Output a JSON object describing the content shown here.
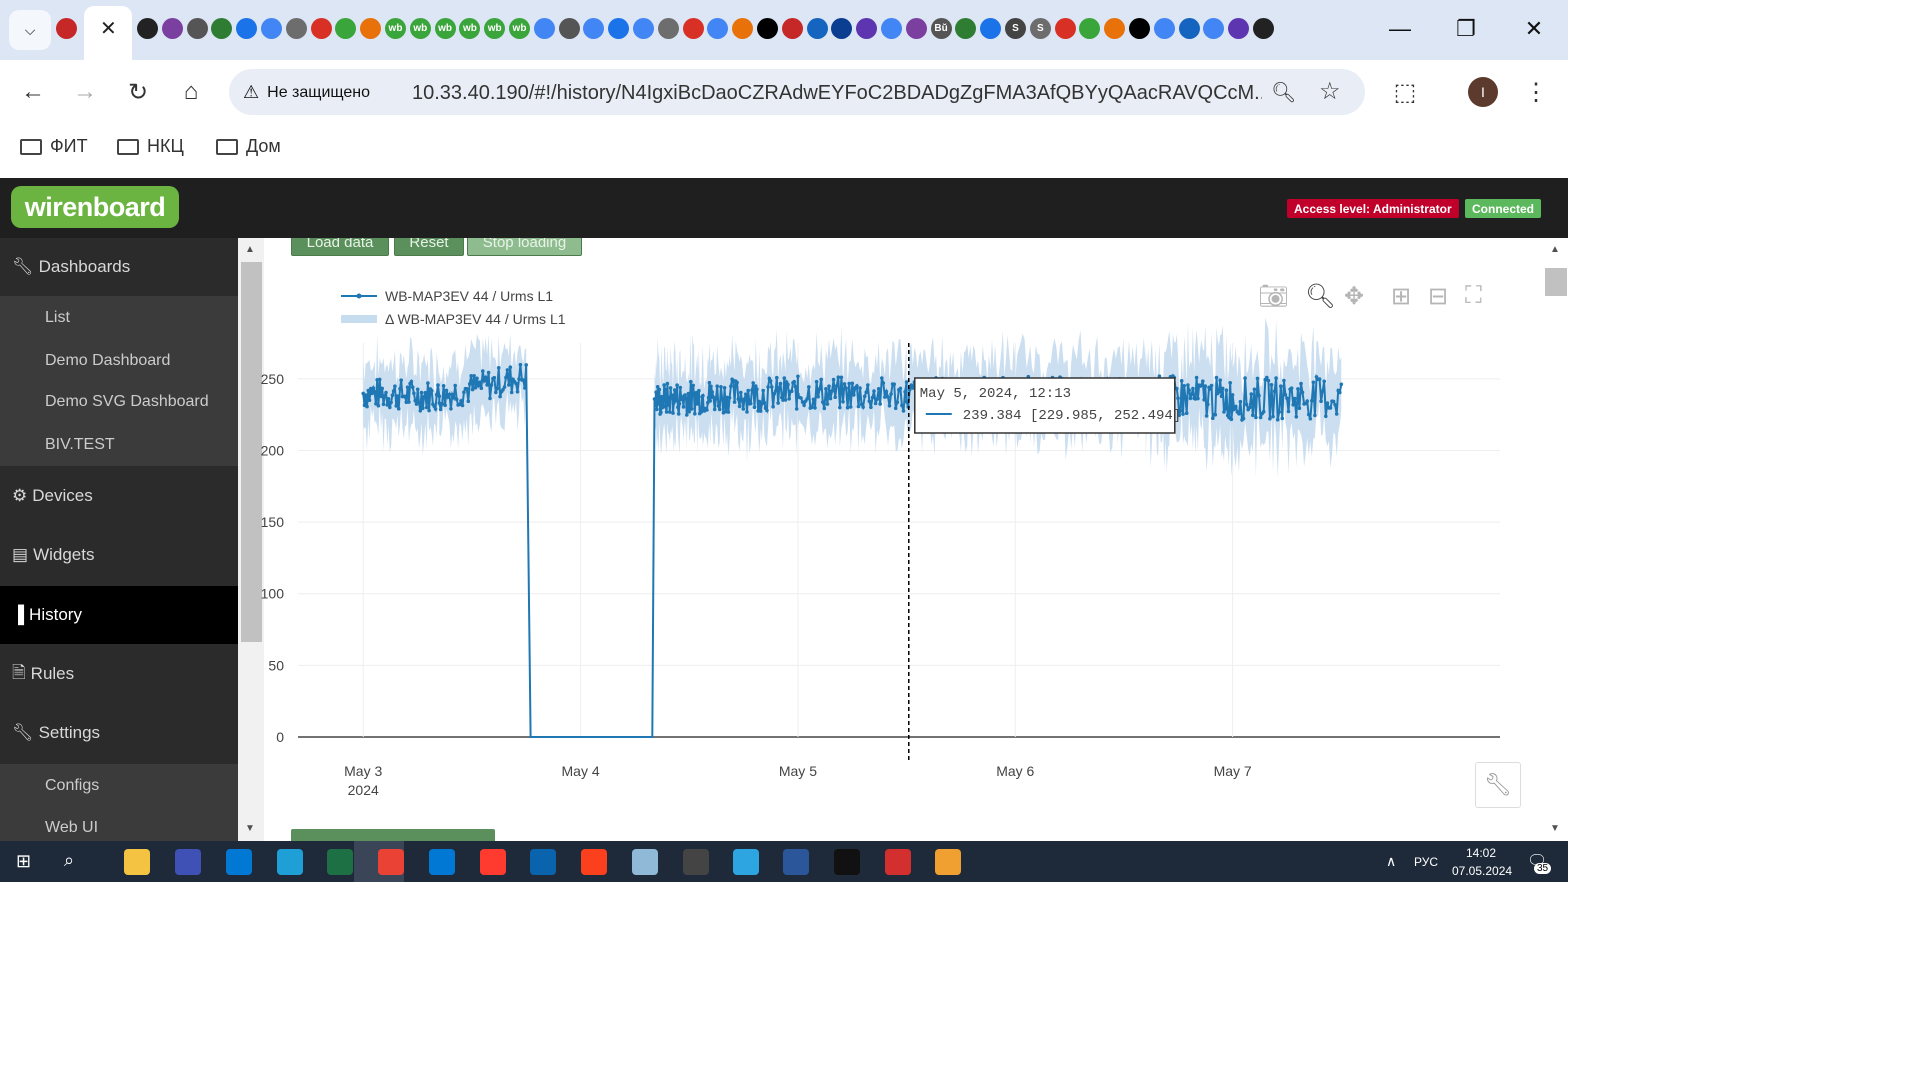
{
  "browser": {
    "tab_icons": [
      "close-icon",
      "x-icon",
      "circle-icon",
      "x-icon",
      "plus-icon",
      "google-icon",
      "aa-icon",
      "gear-icon",
      "circle-icon",
      "gmail-icon",
      "wb",
      "wb",
      "wb",
      "wb",
      "wb",
      "wb",
      "google-icon",
      "circle-icon",
      "google-icon",
      "circle-icon",
      "google-icon",
      "circle-icon",
      "circle-icon",
      "google-icon",
      "circle-icon",
      "circle-icon",
      "x-icon",
      "circle-icon",
      "zotero-icon",
      "book-icon",
      "google-icon",
      "monitor-icon",
      "Bŭ",
      "star-icon",
      "cube-icon",
      "S",
      "S",
      "diamond-icon",
      "cube-icon",
      "monitor-icon",
      "diamond-icon",
      "google-icon",
      "cube-icon",
      "google-icon",
      "plus-icon",
      "list-icon"
    ],
    "new_tab_label": "+",
    "security_label": "Не защищено",
    "url": "10.33.40.190/#!/history/N4IgxiBcDaoCZRAdwEYFoC2BDADgZgFMA3AfQBYyQAacRAVQCcM...",
    "profile_initial": "I",
    "bookmarks": [
      "ФИТ",
      "НКЦ",
      "Дом"
    ]
  },
  "app": {
    "logo": "wirenboard",
    "access_badge": "Access level: Administrator",
    "connection_badge": "Connected",
    "colors": {
      "access": "#c0002a",
      "connected": "#5cb85c",
      "line": "#1f77b4",
      "band": "#c6dcef"
    },
    "sidebar": {
      "dashboards": "Dashboards",
      "dashboard_items": [
        "List",
        "Demo Dashboard",
        "Demo SVG Dashboard",
        "BIV.TEST"
      ],
      "devices": "Devices",
      "widgets": "Widgets",
      "history": "History",
      "rules": "Rules",
      "settings": "Settings",
      "settings_items": [
        "Configs",
        "Web UI"
      ]
    },
    "buttons": {
      "load": "Load data",
      "reset": "Reset",
      "stop": "Stop loading"
    }
  },
  "chart_data": {
    "type": "line",
    "series": [
      {
        "name": "WB-MAP3EV 44 / Urms L1"
      },
      {
        "name": "Δ WB-MAP3EV 44 / Urms L1"
      }
    ],
    "x_ticks": [
      "May 3",
      "May 4",
      "May 5",
      "May 6",
      "May 7"
    ],
    "x_year_label": "2024",
    "y_ticks": [
      "0",
      "50",
      "100",
      "150",
      "200",
      "250"
    ],
    "ylim": [
      0,
      275
    ],
    "grid": true,
    "legend": "top-left",
    "segments": [
      {
        "x": [
          3.0,
          3.35,
          3.75
        ],
        "y": [
          240,
          238,
          252
        ]
      },
      {
        "x": [
          3.75,
          3.77,
          4.33,
          4.34
        ],
        "y": [
          252,
          0,
          0,
          235
        ]
      },
      {
        "x": [
          4.34,
          4.6,
          5.0,
          5.5,
          6.0,
          6.6,
          7.0,
          7.5
        ],
        "y": [
          235,
          238,
          240,
          239,
          240,
          238,
          236,
          237
        ]
      }
    ],
    "tooltip": {
      "date": "May 5, 2024, 12:13",
      "value": "239.384 [229.985, 252.494]"
    }
  },
  "taskbar": {
    "lang": "РУС",
    "time": "14:02",
    "date": "07.05.2024",
    "notifications": "35"
  }
}
